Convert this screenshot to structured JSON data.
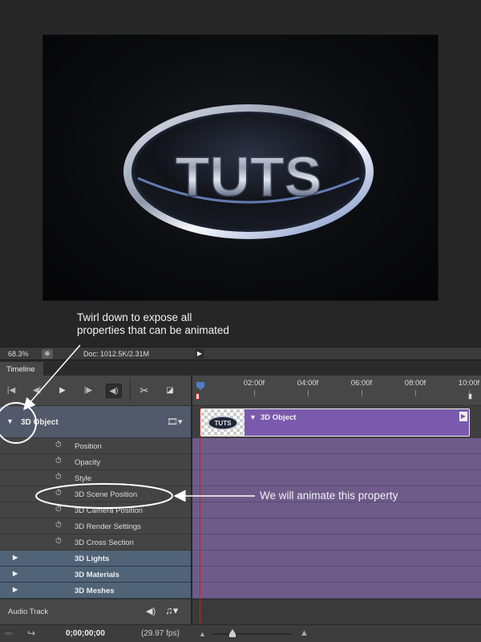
{
  "canvas": {
    "logo_text": "TUTS"
  },
  "annotations": {
    "twirl_line1": "Twirl down to expose all",
    "twirl_line2": "properties that can be animated",
    "animate_label": "We will animate this property"
  },
  "status_bar": {
    "zoom": "68.3%",
    "doc_info": "Doc: 1012.5K/2.31M"
  },
  "panel": {
    "tab": "Timeline"
  },
  "ruler": {
    "ticks": [
      "02:00f",
      "04:00f",
      "06:00f",
      "08:00f",
      "10:00f"
    ]
  },
  "layer": {
    "name": "3D Object",
    "clip_name": "3D Object",
    "thumb_text": "TUTS"
  },
  "properties": [
    "Position",
    "Opacity",
    "Style",
    "3D Scene Position",
    "3D Camera Position",
    "3D Render Settings",
    "3D Cross Section"
  ],
  "groups": [
    "3D Lights",
    "3D Materials",
    "3D Meshes"
  ],
  "audio": {
    "label": "Audio Track"
  },
  "bottom": {
    "timecode": "0;00;00;00",
    "fps": "(29.97 fps)"
  },
  "icons": [
    "go-to-first-frame-icon",
    "previous-frame-icon",
    "play-icon",
    "next-frame-icon",
    "audio-icon",
    "scissors-icon",
    "transition-icon",
    "film-strip-icon",
    "stopwatch-icon",
    "music-note-icon",
    "render-icon",
    "zoom-out-icon",
    "zoom-in-icon"
  ]
}
